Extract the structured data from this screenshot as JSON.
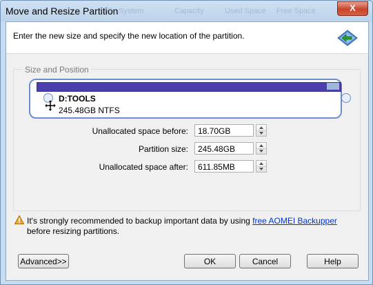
{
  "window": {
    "title": "Move and Resize Partition",
    "close_glyph": "X"
  },
  "background_tabs": [
    "File System",
    "Capacity",
    "Used Space",
    "Free Space"
  ],
  "header": {
    "instruction": "Enter the new size and specify the new location of the partition.",
    "icon": "resize-arrow-icon"
  },
  "group": {
    "label": "Size and Position",
    "partition": {
      "name": "D:TOOLS",
      "size_fs": "245.48GB NTFS"
    },
    "colors": {
      "bar": "#4b3fae",
      "panel_border": "#6b8fc8",
      "unused_tail": "#9fb6db"
    }
  },
  "fields": [
    {
      "label": "Unallocated space before:",
      "value": "18.70GB"
    },
    {
      "label": "Partition size:",
      "value": "245.48GB"
    },
    {
      "label": "Unallocated space after:",
      "value": "611.85MB"
    }
  ],
  "warning": {
    "icon": "warning-triangle-icon",
    "text_before": "It's strongly recommended to backup important data by using ",
    "link": "free AOMEI Backupper",
    "text_after": " before resizing partitions."
  },
  "buttons": {
    "advanced": "Advanced>>",
    "ok": "OK",
    "cancel": "Cancel",
    "help": "Help"
  }
}
